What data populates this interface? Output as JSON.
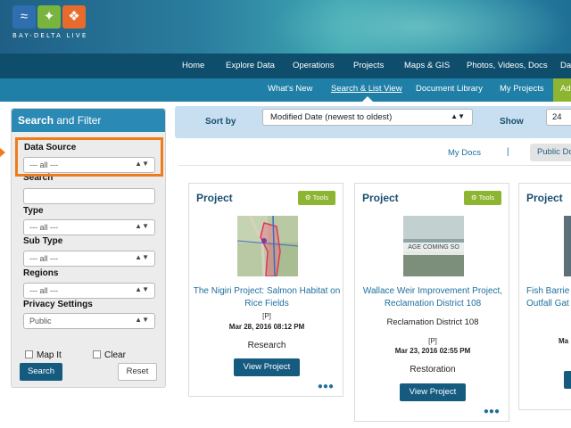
{
  "brand": {
    "name": "BAY-DELTA LIVE",
    "colors": {
      "blue": "#2f6fb0",
      "green": "#78b43e",
      "orange": "#e86a2c"
    }
  },
  "main_nav": [
    "Home",
    "Explore Data",
    "Operations",
    "Projects",
    "Maps & GIS",
    "Photos, Videos, Docs",
    "Da"
  ],
  "sub_nav": {
    "items": [
      "What's New",
      "Search & List View",
      "Document Library",
      "My Projects"
    ],
    "active": "Search & List View",
    "add_label": "Ad"
  },
  "sidebar": {
    "title_bold": "Search",
    "title_rest": " and Filter",
    "data_source_label": "Data Source",
    "data_source_value": "--- all ---",
    "search_label": "Search",
    "type_label": "Type",
    "type_value": "--- all ---",
    "subtype_label": "Sub Type",
    "subtype_value": "--- all ---",
    "regions_label": "Regions",
    "regions_value": "--- all ---",
    "privacy_label": "Privacy Settings",
    "privacy_value": "Public",
    "map_it_label": "Map It",
    "clear_label": "Clear",
    "search_button": "Search",
    "reset_button": "Reset"
  },
  "sort_bar": {
    "sort_label": "Sort by",
    "sort_value": "Modified Date (newest to oldest)",
    "show_label": "Show",
    "show_value": "24"
  },
  "docs_tabs": {
    "my_docs": "My Docs",
    "separator": "|",
    "public_docs": "Public Do"
  },
  "cards": [
    {
      "title": "Project",
      "tools": "Tools",
      "name": "The Nigiri Project: Salmon Habitat on Rice Fields",
      "privacy": "[P]",
      "date": "Mar 28, 2016 08:12 PM",
      "category": "Research",
      "button": "View Project"
    },
    {
      "title": "Project",
      "tools": "Tools",
      "thumb_text": "AGE COMING SO",
      "name": "Wallace Weir Improvement Project, Reclamation District 108",
      "district": "Reclamation District 108",
      "privacy": "[P]",
      "date": "Mar 23, 2016 02:55 PM",
      "category": "Restoration",
      "button": "View Project"
    },
    {
      "title": "Project",
      "name": "Fish Barrie Outfall Gat",
      "date_fragment": "Ma"
    }
  ]
}
